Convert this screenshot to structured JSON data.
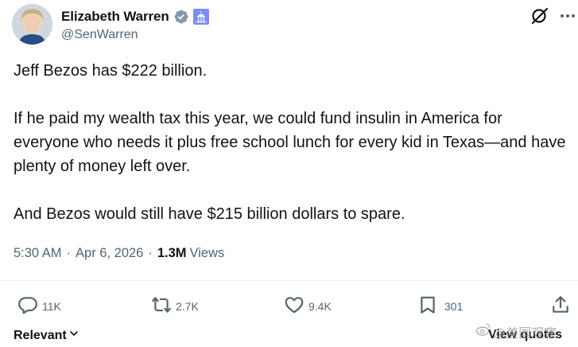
{
  "author": {
    "display_name": "Elizabeth Warren",
    "handle": "@SenWarren"
  },
  "tweet": {
    "paragraphs": [
      "Jeff Bezos has $222 billion.",
      "If he paid my wealth tax this year, we could fund insulin in America for everyone who needs it plus free school lunch for every kid in Texas—and have plenty of money left over.",
      "And Bezos would still have $215 billion dollars to spare."
    ],
    "time": "5:30 AM",
    "date": "Apr 6, 2026",
    "views_count": "1.3M",
    "views_label": "Views"
  },
  "actions": {
    "replies": "11K",
    "reposts": "2.7K",
    "likes": "9.4K",
    "bookmarks": "301"
  },
  "bottom": {
    "sort_label": "Relevant",
    "view_quotes_label": "View quotes"
  },
  "watermark": {
    "text": "@美国观察"
  },
  "colors": {
    "text": "#0f1419",
    "secondary": "#536471",
    "verified": "#829aab",
    "gov_badge": "#7b8ff2",
    "divider": "#eff3f4"
  },
  "icons": [
    "grok-icon",
    "more-icon",
    "verified-badge-icon",
    "government-badge-icon",
    "reply-icon",
    "repost-icon",
    "like-icon",
    "bookmark-icon",
    "share-icon",
    "chevron-down-icon"
  ]
}
